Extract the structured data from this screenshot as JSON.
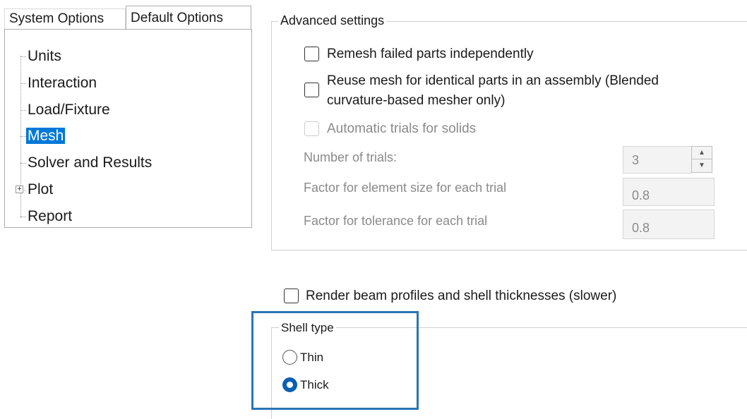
{
  "tabs": [
    "System Options",
    "Default Options"
  ],
  "tree": {
    "items": [
      {
        "label": "Units",
        "selected": false
      },
      {
        "label": "Interaction",
        "selected": false
      },
      {
        "label": "Load/Fixture",
        "selected": false
      },
      {
        "label": "Mesh",
        "selected": true
      },
      {
        "label": "Solver and Results",
        "selected": false
      },
      {
        "label": "Plot",
        "selected": false,
        "expandable": true
      },
      {
        "label": "Report",
        "selected": false
      }
    ],
    "expander_symbol": "+"
  },
  "advanced": {
    "title": "Advanced settings",
    "remesh_label": "Remesh failed parts independently",
    "reuse_label_line1": "Reuse mesh for identical parts in an assembly (Blended",
    "reuse_label_line2": "curvature-based mesher only)",
    "auto_trials_label": "Automatic trials for solids",
    "num_trials_label": "Number of trials:",
    "num_trials_value": "3",
    "factor_element_label": "Factor for element size for each trial",
    "factor_element_value": "0.8",
    "factor_tolerance_label": "Factor for tolerance for each trial",
    "factor_tolerance_value": "0.8"
  },
  "render_beam_label": "Render beam profiles and shell thicknesses (slower)",
  "shell": {
    "title": "Shell type",
    "thin_label": "Thin",
    "thick_label": "Thick",
    "selected": "Thick"
  },
  "colors": {
    "selection": "#0078d7",
    "highlight_border": "#2a74b6",
    "radio_checked": "#0a5fb5"
  }
}
